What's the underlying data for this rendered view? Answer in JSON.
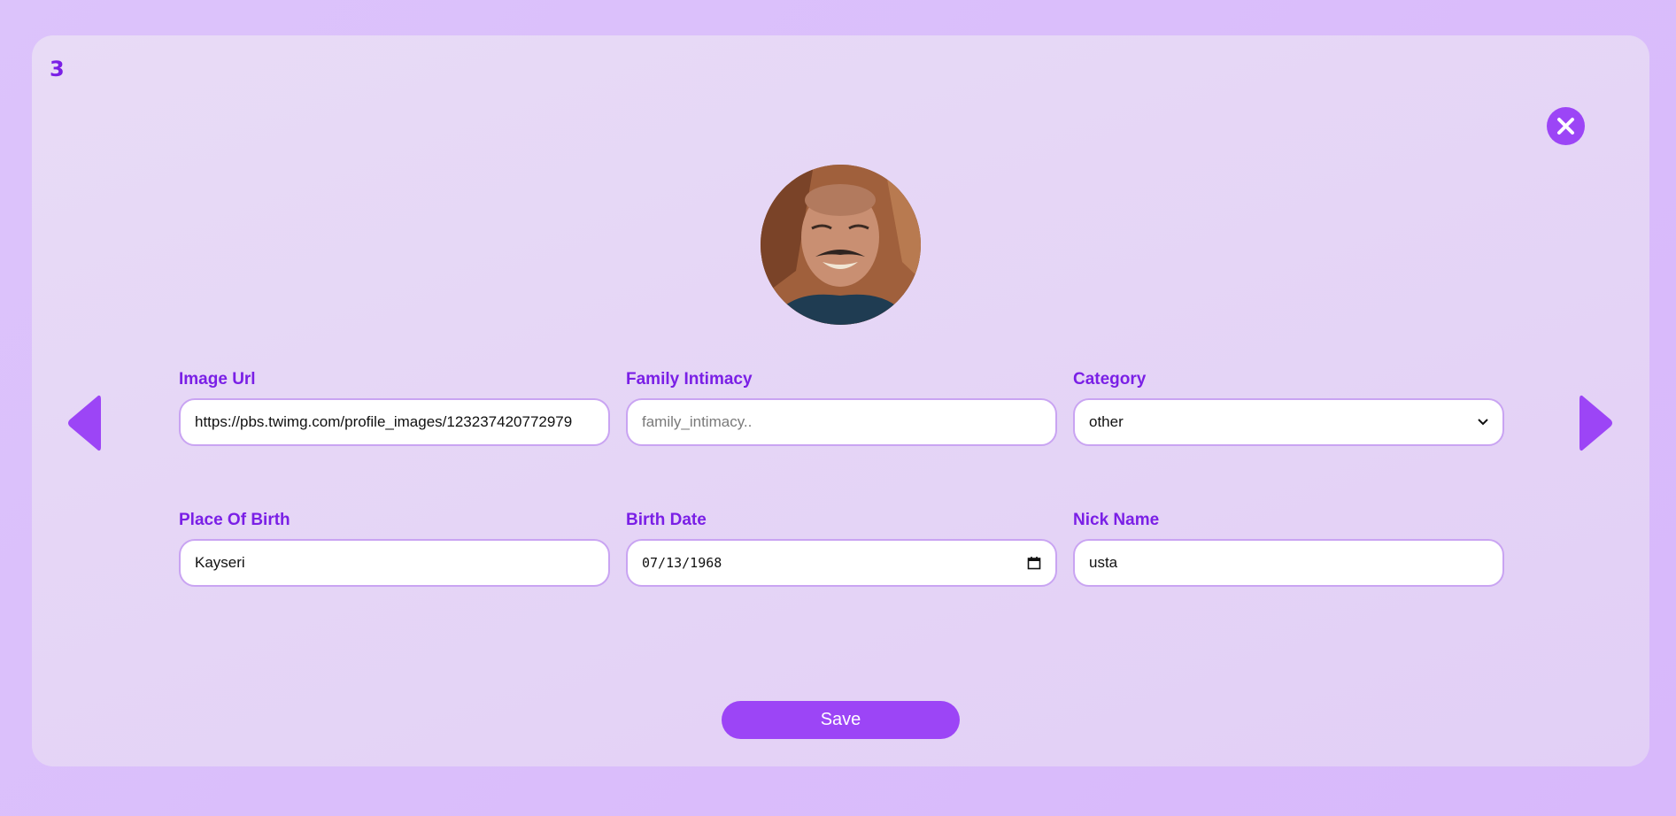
{
  "page_number": "3",
  "avatar": {
    "alt": "profile photo"
  },
  "fields": {
    "image_url": {
      "label": "Image Url",
      "value": "https://pbs.twimg.com/profile_images/123237420772979"
    },
    "family_intimacy": {
      "label": "Family Intimacy",
      "placeholder": "family_intimacy.."
    },
    "category": {
      "label": "Category",
      "selected": "other"
    },
    "place_of_birth": {
      "label": "Place Of Birth",
      "value": "Kayseri"
    },
    "birth_date": {
      "label": "Birth Date",
      "value": "07/13/1968"
    },
    "nick_name": {
      "label": "Nick Name",
      "value": "usta"
    }
  },
  "save_label": "Save",
  "colors": {
    "accent": "#9c45f6",
    "label": "#7a1fe6",
    "border": "#c9a4f2"
  },
  "icons": {
    "close": "close-icon",
    "prev": "arrow-left-icon",
    "next": "arrow-right-icon",
    "calendar": "calendar-icon",
    "dropdown": "chevron-down-icon"
  }
}
